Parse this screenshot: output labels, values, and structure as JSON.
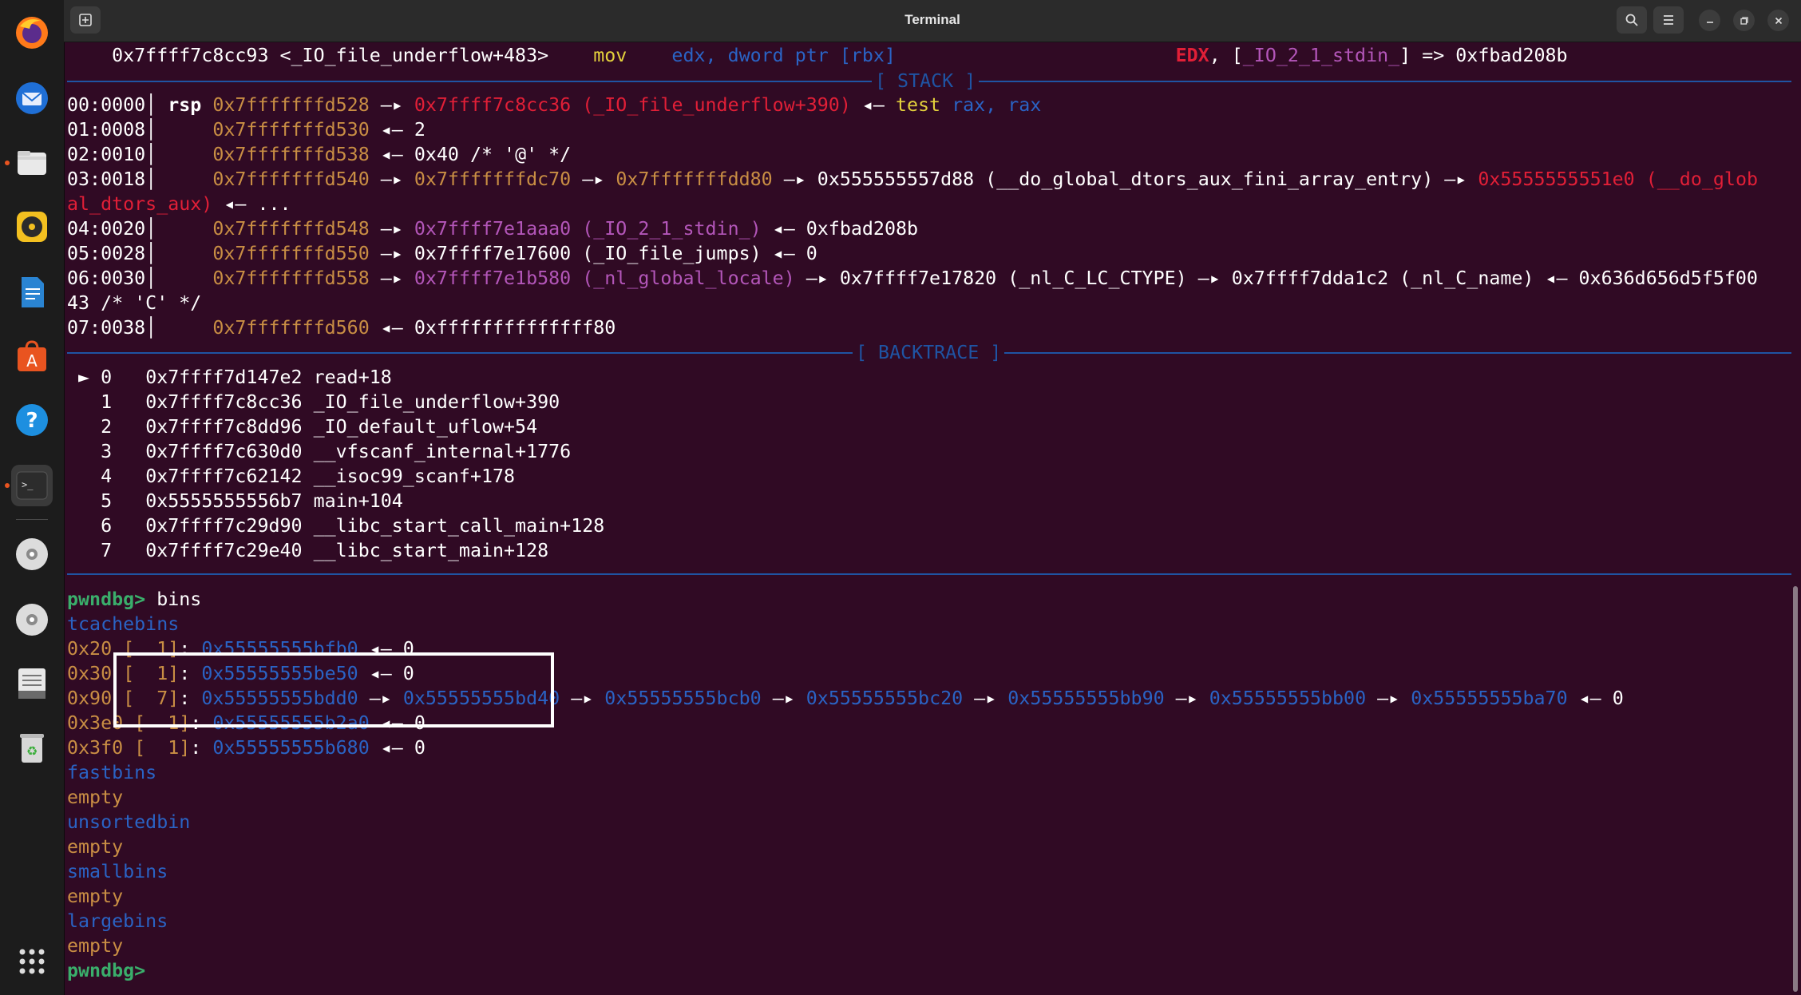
{
  "window": {
    "title": "Terminal"
  },
  "dock": {
    "apps": [
      {
        "name": "firefox-icon"
      },
      {
        "name": "thunderbird-icon"
      },
      {
        "name": "files-icon"
      },
      {
        "name": "rhythmbox-icon"
      },
      {
        "name": "writer-icon"
      },
      {
        "name": "app-center-icon"
      },
      {
        "name": "help-icon"
      },
      {
        "name": "terminal-icon"
      },
      {
        "name": "disc-icon"
      },
      {
        "name": "disc-icon-2"
      },
      {
        "name": "text-editor-icon"
      },
      {
        "name": "trash-icon"
      }
    ]
  },
  "terminal": {
    "current_instruction": {
      "addr": "0x7ffff7c8cc93 <_IO_file_underflow+483>",
      "mnemonic": "mov",
      "reg": "edx,",
      "operand": "dword ptr",
      "mem": "[rbx]",
      "comment_reg": "EDX",
      "comment_sep": ", [",
      "comment_sym": "_IO_2_1_stdin_",
      "comment_rest": "] => 0xfbad208b"
    },
    "stack_title": "[ STACK ]",
    "stack": [
      {
        "off": "00:0000│",
        "reg": " rsp ",
        "addr": "0x7fffffffd528",
        "arrow": " —▸ ",
        "val": "0x7ffff7c8cc36 (_IO_file_underflow+390)",
        "rest_arrow": " ◂— ",
        "ins": "test",
        "ins_ops": " rax, rax"
      },
      {
        "off": "01:0008│",
        "addr": "0x7fffffffd530",
        "rest": " ◂— 2"
      },
      {
        "off": "02:0010│",
        "addr": "0x7fffffffd538",
        "rest": " ◂— 0x40 /* '@' */"
      },
      {
        "off": "03:0018│",
        "addr": "0x7fffffffd540",
        "a1": " —▸ ",
        "v1": "0x7fffffffdc70",
        "a2": " —▸ ",
        "v2": "0x7fffffffdd80",
        "a3": " —▸ 0x555555557d88 (__do_global_dtors_aux_fini_array_entry) —▸ ",
        "v3": "0x5555555551e0 (__do_glob",
        "wrap": "al_dtors_aux)",
        "wrap_rest": " ◂— ..."
      },
      {
        "off": "04:0020│",
        "addr": "0x7fffffffd548",
        "a1": " —▸ ",
        "v1": "0x7ffff7e1aaa0 (_IO_2_1_stdin_)",
        "rest": " ◂— 0xfbad208b"
      },
      {
        "off": "05:0028│",
        "addr": "0x7fffffffd550",
        "rest": " —▸ 0x7ffff7e17600 (_IO_file_jumps) ◂— 0"
      },
      {
        "off": "06:0030│",
        "addr": "0x7fffffffd558",
        "a1": " —▸ ",
        "v1": "0x7ffff7e1b580 (_nl_global_locale)",
        "rest": " —▸ 0x7ffff7e17820 (_nl_C_LC_CTYPE) —▸ 0x7ffff7dda1c2 (_nl_C_name) ◂— 0x636d656d5f5f00",
        "wrap": "43 /* 'C' */"
      },
      {
        "off": "07:0038│",
        "addr": "0x7fffffffd560",
        "rest": " ◂— 0xffffffffffffff80"
      }
    ],
    "backtrace_title": "[ BACKTRACE ]",
    "backtrace": [
      {
        "marker": " ► ",
        "idx": "0",
        "addr": "0x7ffff7d147e2",
        "sym": "read+18"
      },
      {
        "marker": "   ",
        "idx": "1",
        "addr": "0x7ffff7c8cc36",
        "sym": "_IO_file_underflow+390"
      },
      {
        "marker": "   ",
        "idx": "2",
        "addr": "0x7ffff7c8dd96",
        "sym": "_IO_default_uflow+54"
      },
      {
        "marker": "   ",
        "idx": "3",
        "addr": "0x7ffff7c630d0",
        "sym": "__vfscanf_internal+1776"
      },
      {
        "marker": "   ",
        "idx": "4",
        "addr": "0x7ffff7c62142",
        "sym": "__isoc99_scanf+178"
      },
      {
        "marker": "   ",
        "idx": "5",
        "addr": "0x5555555556b7",
        "sym": "main+104"
      },
      {
        "marker": "   ",
        "idx": "6",
        "addr": "0x7ffff7c29d90",
        "sym": "__libc_start_call_main+128"
      },
      {
        "marker": "   ",
        "idx": "7",
        "addr": "0x7ffff7c29e40",
        "sym": "__libc_start_main+128"
      }
    ],
    "prompt": "pwndbg>",
    "command": " bins",
    "bins": {
      "tcache_label": "tcachebins",
      "tcache": [
        {
          "size": "0x20",
          "count": " [  1]",
          "colon": ": ",
          "chain": [
            "0x55555555bfb0"
          ],
          "end": " ◂— 0"
        },
        {
          "size": "0x30",
          "count": " [  1]",
          "colon": ": ",
          "chain": [
            "0x55555555be50"
          ],
          "end": " ◂— 0"
        },
        {
          "size": "0x90",
          "count": " [  7]",
          "colon": ": ",
          "chain": [
            "0x55555555bdd0",
            "0x55555555bd40",
            "0x55555555bcb0",
            "0x55555555bc20",
            "0x55555555bb90",
            "0x55555555bb00",
            "0x55555555ba70"
          ],
          "end": " ◂— 0"
        },
        {
          "size": "0x3e0",
          "count": " [  1]",
          "colon": ": ",
          "chain": [
            "0x55555555b2a0"
          ],
          "end": " ◂— 0"
        },
        {
          "size": "0x3f0",
          "count": " [  1]",
          "colon": ": ",
          "chain": [
            "0x55555555b680"
          ],
          "end": " ◂— 0"
        }
      ],
      "fastbins_label": "fastbins",
      "fastbins_value": "empty",
      "unsorted_label": "unsortedbin",
      "unsorted_value": "empty",
      "small_label": "smallbins",
      "small_value": "empty",
      "large_label": "largebins",
      "large_value": "empty"
    },
    "final_prompt": "pwndbg>"
  },
  "colors": {
    "background": "#300a24",
    "address_orange": "#c98e44",
    "code_red": "#e11f37",
    "data_magenta": "#b356b9",
    "heap_blue": "#2a63c4",
    "prompt_green": "#3aae6b"
  }
}
